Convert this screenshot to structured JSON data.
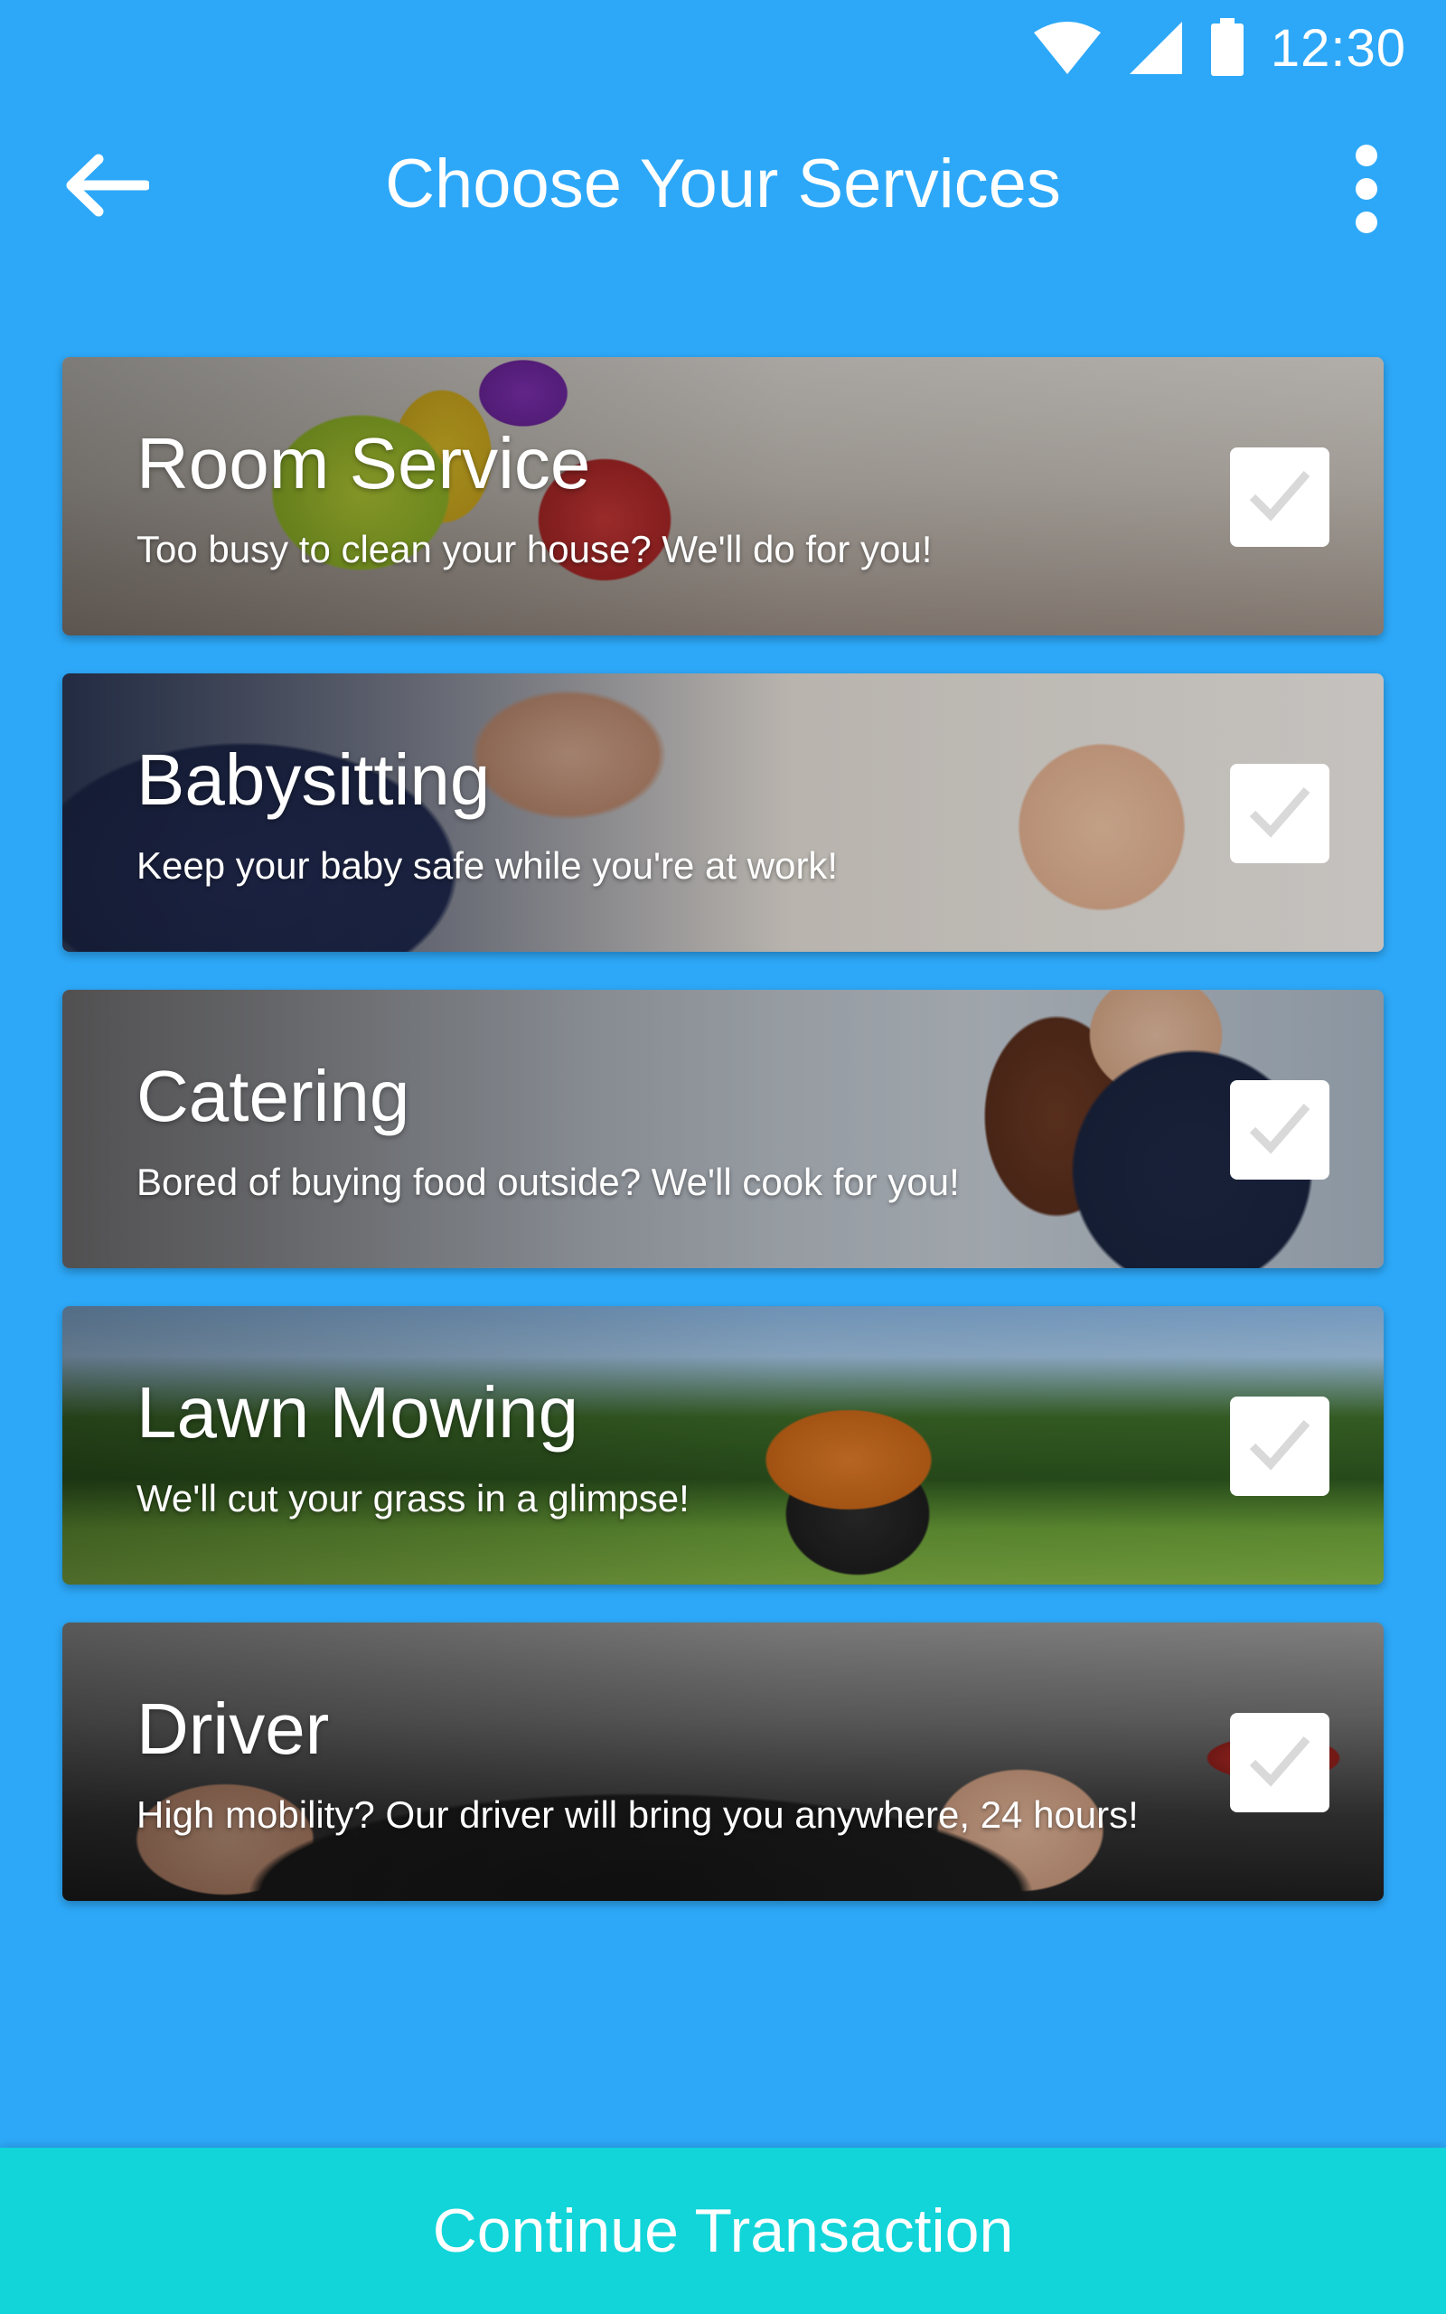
{
  "status_bar": {
    "time": "12:30",
    "icons": [
      "wifi-icon",
      "cell-signal-icon",
      "battery-icon"
    ]
  },
  "app_bar": {
    "title": "Choose Your Services",
    "back_icon": "arrow-left-icon",
    "menu_icon": "more-vertical-icon"
  },
  "services": [
    {
      "title": "Room Service",
      "subtitle": "Too busy to clean your house? We'll do for you!",
      "checked": false
    },
    {
      "title": "Babysitting",
      "subtitle": "Keep your baby safe while you're at work!",
      "checked": false
    },
    {
      "title": "Catering",
      "subtitle": "Bored of buying food outside? We'll cook for you!",
      "checked": false
    },
    {
      "title": "Lawn Mowing",
      "subtitle": "We'll cut your grass in a glimpse!",
      "checked": false
    },
    {
      "title": "Driver",
      "subtitle": "High mobility? Our driver will bring you anywhere, 24 hours!",
      "checked": false
    }
  ],
  "continue_button": {
    "label": "Continue Transaction"
  },
  "colors": {
    "background": "#2da8f8",
    "button": "#11d5d9",
    "checkmark": "#d9d9d9"
  }
}
